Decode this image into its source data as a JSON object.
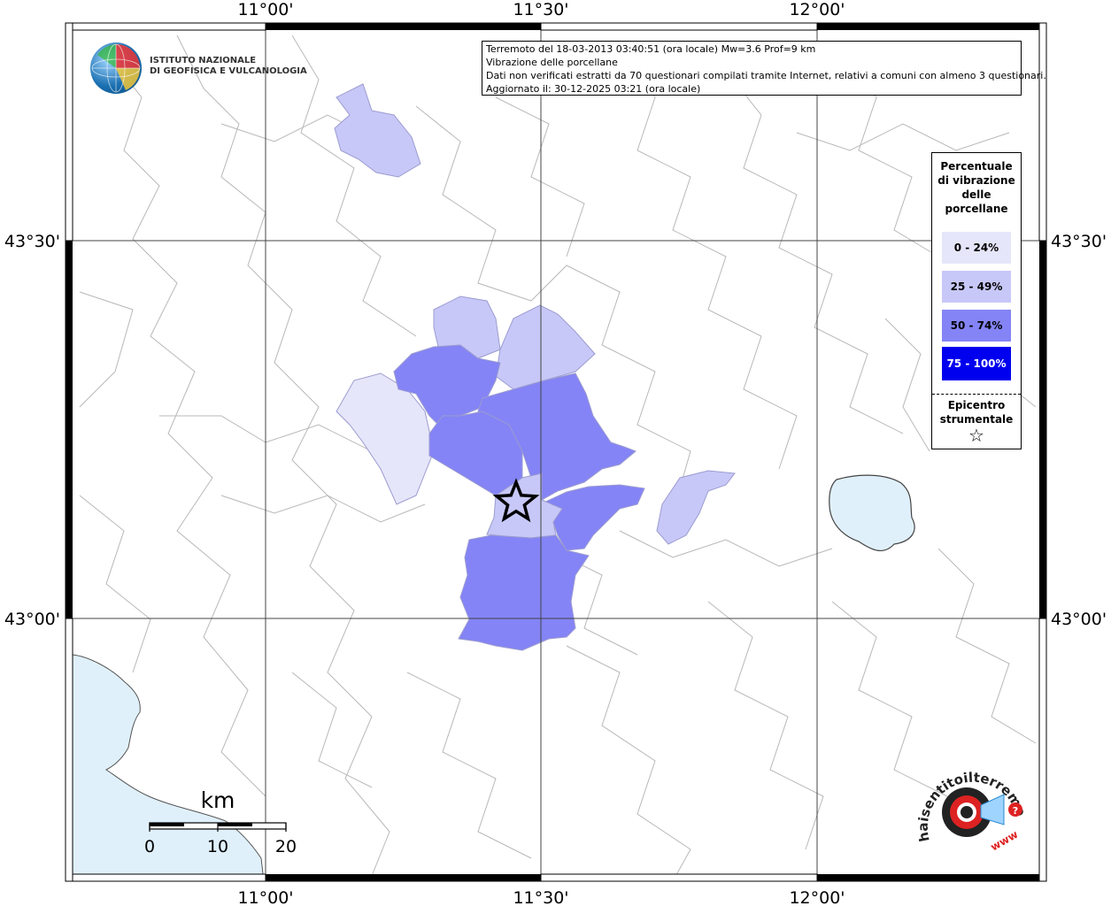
{
  "map": {
    "lon_ticks": [
      "11°00'",
      "11°30'",
      "12°00'"
    ],
    "lat_ticks": [
      "43°30'",
      "43°00'"
    ],
    "colors": {
      "class_0_24": "#e6e6fa",
      "class_25_49": "#c8c8f8",
      "class_50_74": "#8484f6",
      "class_75_100": "#0000ee",
      "water": "#e0f0fb",
      "borders": "#b8b8b8"
    }
  },
  "info": {
    "line1": "Terremoto del 18-03-2013 03:40:51 (ora locale) Mw=3.6 Prof=9 km",
    "line2": "Vibrazione delle porcellane",
    "line3": "Dati non verificati estratti da 70 questionari compilati tramite Internet, relativi a comuni con almeno 3 questionari.",
    "line4": "Aggiornato il: 30-12-2025 03:21 (ora locale)"
  },
  "legend": {
    "title_lines": [
      "Percentuale",
      "di vibrazione",
      "delle",
      "porcellane"
    ],
    "classes": [
      {
        "label": "0 - 24%",
        "color": "#e6e6fa",
        "text_color": "#000000"
      },
      {
        "label": "25 - 49%",
        "color": "#c8c8f8",
        "text_color": "#000000"
      },
      {
        "label": "50 - 74%",
        "color": "#8484f6",
        "text_color": "#000000"
      },
      {
        "label": "75 - 100%",
        "color": "#0000ee",
        "text_color": "#ffffff"
      }
    ],
    "epicenter_lines": [
      "Epicentro",
      "strumentale"
    ],
    "epicenter_icon": "star-icon"
  },
  "scalebar": {
    "unit": "km",
    "labels": [
      "0",
      "10",
      "20"
    ]
  },
  "logos": {
    "ingv_line1": "ISTITUTO NAZIONALE",
    "ingv_line2": "DI GEOFISICA E VULCANOLOGIA",
    "hst_text": "haisentitoilterremoto.it",
    "hst_www": "www"
  }
}
